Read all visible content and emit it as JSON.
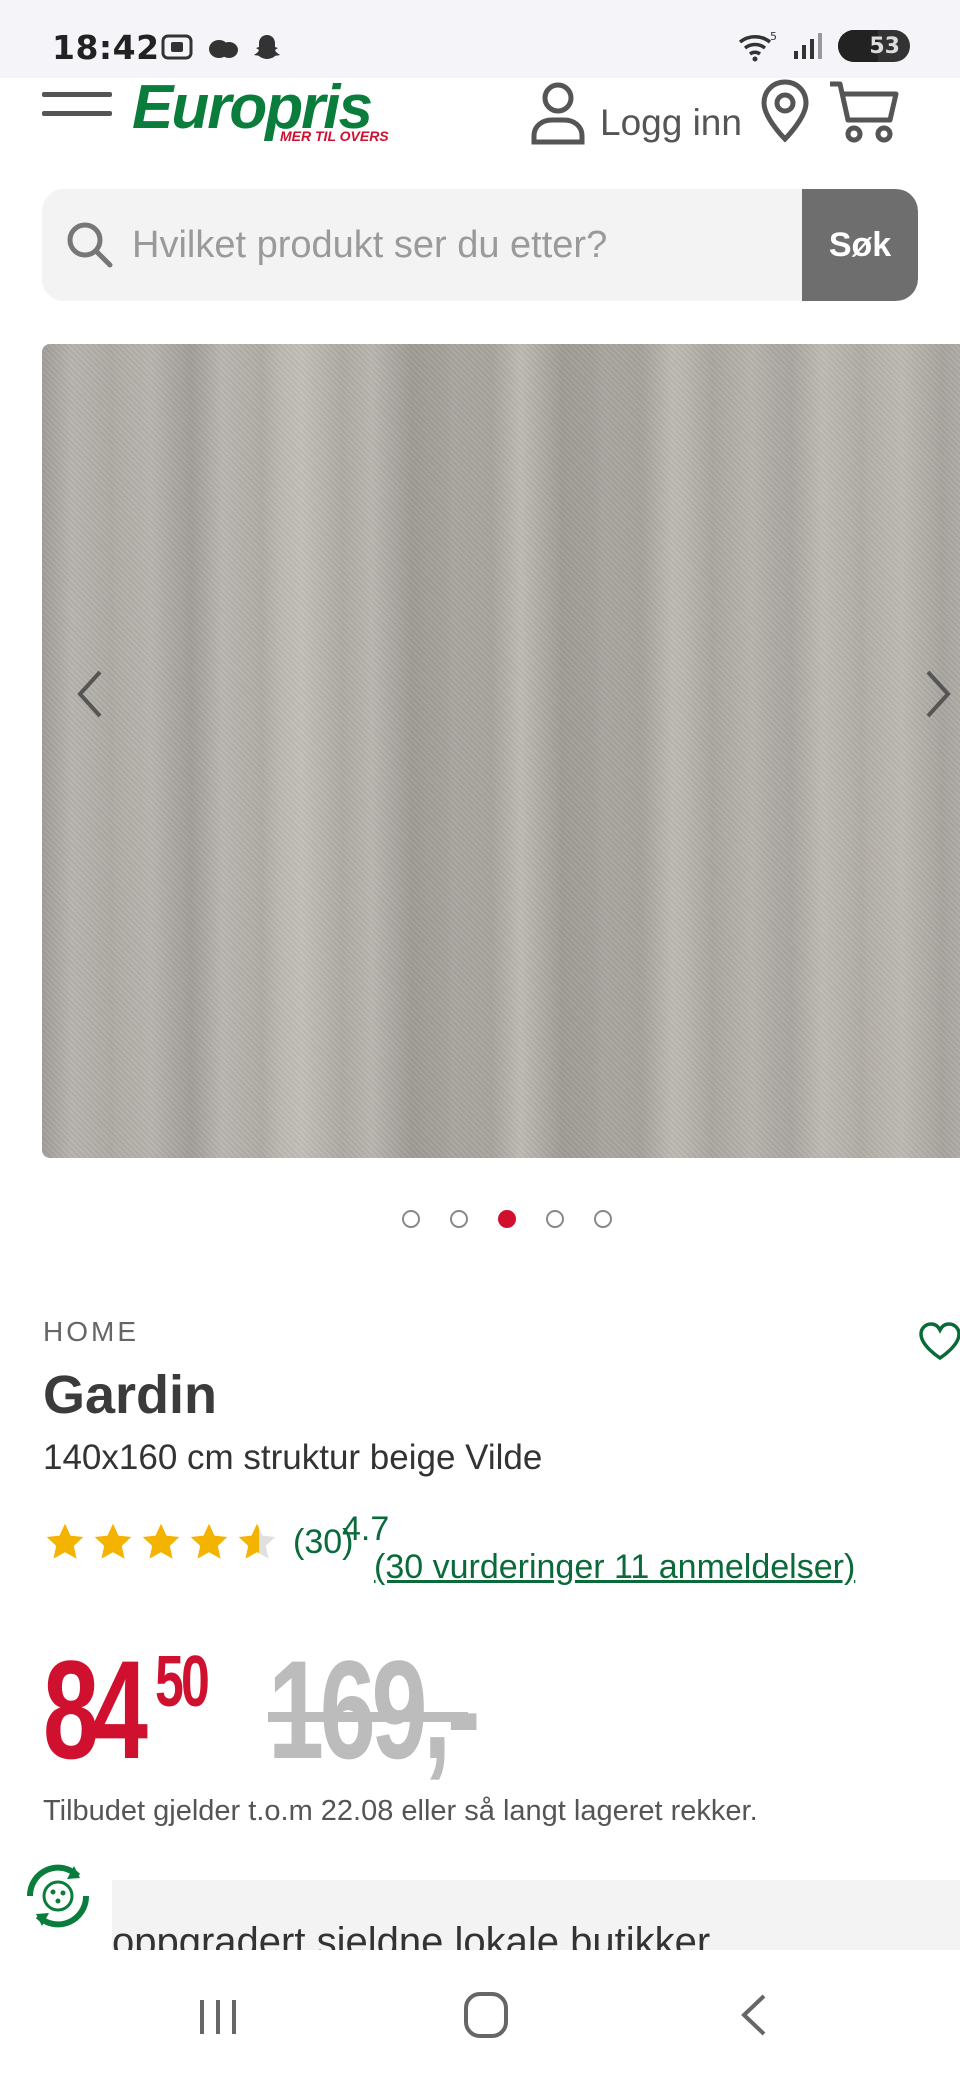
{
  "status_bar": {
    "time": "18:42",
    "battery": "53",
    "left_icons": [
      "screenshot-icon",
      "cloud-icon",
      "snapchat-icon"
    ],
    "right_icons": [
      "wifi-icon",
      "signal-icon",
      "battery-icon"
    ]
  },
  "header": {
    "logo_text": "Europris",
    "logo_tagline": "MER TIL OVERS",
    "login_label": "Logg inn",
    "icons": [
      "menu-icon",
      "user-icon",
      "location-pin-icon",
      "cart-icon"
    ]
  },
  "search": {
    "placeholder": "Hvilket produkt ser du etter?",
    "button_label": "Søk"
  },
  "carousel": {
    "slide_count": 5,
    "active_index": 2
  },
  "product": {
    "brand": "HOME",
    "title": "Gardin",
    "subtitle": "140x160 cm struktur beige Vilde",
    "rating": {
      "stars": 4.7,
      "count_label": "(30)",
      "score": "4.7",
      "reviews_link": "(30 vurderinger 11 anmeldelser)"
    },
    "price": {
      "integer": "84",
      "decimals": "50",
      "old_price": "169,-"
    },
    "offer_note": "Tilbudet gjelder t.o.m 22.08 eller så langt lageret rekker.",
    "next_section_text": "oppgradert sjeldne lokale butikker"
  },
  "colors": {
    "brand_green": "#0a7d3d",
    "price_red": "#d0102f",
    "link_green": "#0a6a3a",
    "star_gold": "#f5b301"
  }
}
